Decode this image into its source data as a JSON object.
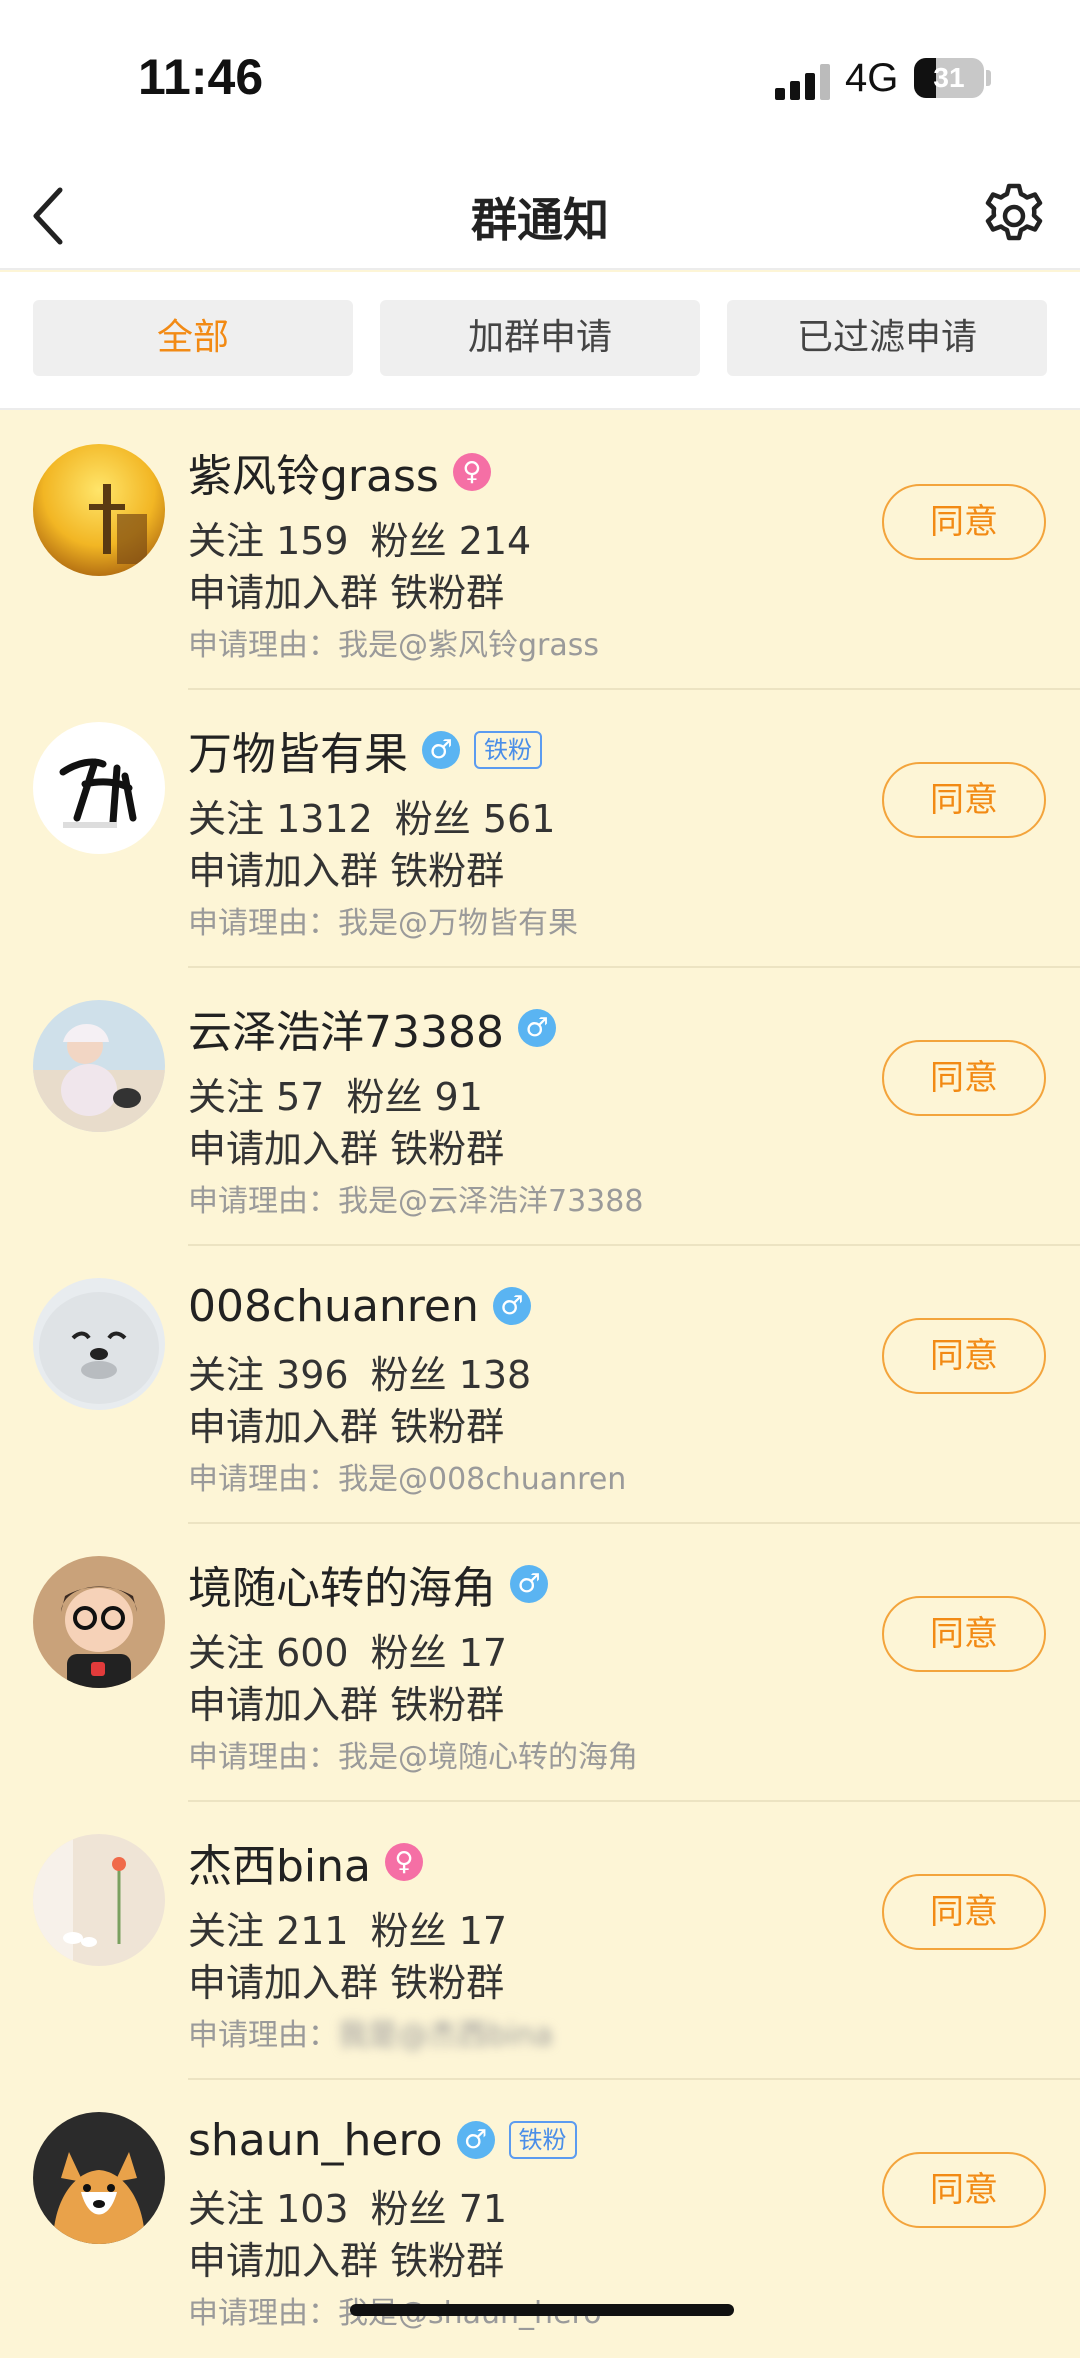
{
  "status_bar": {
    "time": "11:46",
    "network": "4G",
    "battery": "31"
  },
  "header": {
    "title": "群通知"
  },
  "filters": [
    {
      "label": "全部",
      "active": true
    },
    {
      "label": "加群申请",
      "active": false
    },
    {
      "label": "已过滤申请",
      "active": false
    }
  ],
  "requests": [
    {
      "name": "紫风铃grass",
      "gender": "female",
      "badge": "",
      "follow": "关注 159",
      "fans": "粉丝 214",
      "group_line": "申请加入群 铁粉群",
      "reason_label": "申请理由：",
      "reason_text": "我是@紫风铃grass",
      "button": "同意"
    },
    {
      "name": "万物皆有果",
      "gender": "male",
      "badge": "铁粉",
      "follow": "关注 1312",
      "fans": "粉丝 561",
      "group_line": "申请加入群 铁粉群",
      "reason_label": "申请理由：",
      "reason_text": "我是@万物皆有果",
      "button": "同意"
    },
    {
      "name": "云泽浩洋73388",
      "gender": "male",
      "badge": "",
      "follow": "关注 57",
      "fans": "粉丝 91",
      "group_line": "申请加入群 铁粉群",
      "reason_label": "申请理由：",
      "reason_text": "我是@云泽浩洋73388",
      "button": "同意"
    },
    {
      "name": "008chuanren",
      "gender": "male",
      "badge": "",
      "follow": "关注 396",
      "fans": "粉丝 138",
      "group_line": "申请加入群 铁粉群",
      "reason_label": "申请理由：",
      "reason_text": "我是@008chuanren",
      "button": "同意"
    },
    {
      "name": "境随心转的海角",
      "gender": "male",
      "badge": "",
      "follow": "关注 600",
      "fans": "粉丝 17",
      "group_line": "申请加入群 铁粉群",
      "reason_label": "申请理由：",
      "reason_text": "我是@境随心转的海角",
      "button": "同意"
    },
    {
      "name": "杰西bina",
      "gender": "female",
      "badge": "",
      "follow": "关注 211",
      "fans": "粉丝 17",
      "group_line": "申请加入群 铁粉群",
      "reason_label": "申请理由：",
      "reason_text": "我是@杰西bina",
      "button": "同意"
    },
    {
      "name": "shaun_hero",
      "gender": "male",
      "badge": "铁粉",
      "follow": "关注 103",
      "fans": "粉丝 71",
      "group_line": "申请加入群 铁粉群",
      "reason_label": "申请理由：",
      "reason_text": "我是@shaun_hero",
      "button": "同意"
    }
  ],
  "icons": {
    "back": "chevron-left-icon",
    "settings": "gear-icon",
    "female": "female-icon",
    "male": "male-icon"
  },
  "colors": {
    "accent": "#f28a14",
    "list_bg": "#fdf5d6",
    "female": "#f56fa5",
    "male": "#5ab4f2",
    "badge": "#4a8ee8"
  }
}
